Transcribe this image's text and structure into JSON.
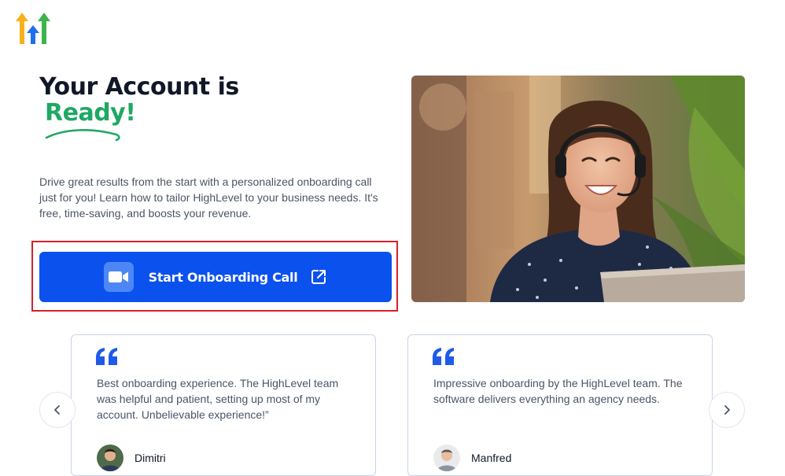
{
  "brand": {
    "logo_icon": "highlevel-arrows-logo-icon",
    "colors": [
      "#f6b21b",
      "#1f6ef0",
      "#3bb44a"
    ]
  },
  "hero": {
    "title_line1": "Your Account is",
    "title_line2": "Ready!",
    "description": "Drive great results from the start with a personalized onboarding call just for you! Learn how to tailor HighLevel to your business needs. It's free, time-saving, and boosts your revenue."
  },
  "cta": {
    "label": "Start Onboarding Call",
    "leading_icon": "zoom-video-icon",
    "trailing_icon": "external-link-icon",
    "color": "#0b51ee",
    "highlight_color": "#d71f2b"
  },
  "accent": {
    "green": "#1fa864",
    "blue": "#0b51ee"
  },
  "testimonials": [
    {
      "quote": "Best onboarding experience. The HighLevel team was helpful and patient, setting up most of my account. Unbelievable experience!”",
      "author": "Dimitri"
    },
    {
      "quote": "Impressive onboarding by the HighLevel team. The software delivers everything an agency needs.",
      "author": "Manfred"
    }
  ],
  "carousel": {
    "prev_icon": "chevron-left-icon",
    "next_icon": "chevron-right-icon"
  }
}
